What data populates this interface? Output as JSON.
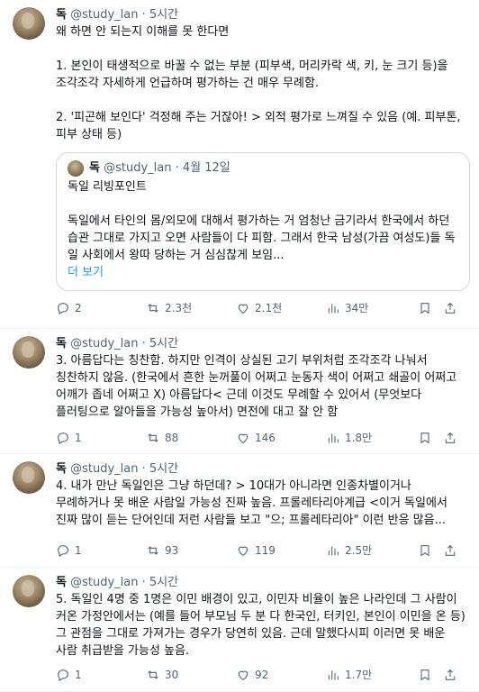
{
  "tweets": [
    {
      "name": "독",
      "handle": "@study_lan",
      "sep": "·",
      "time": "5시간",
      "paragraphs": [
        "왜 하면 안 되는지 이해를 못 한다면",
        "",
        "1. 본인이 태생적으로 바꿀 수 없는 부분 (피부색, 머리카락 색, 키, 눈 크기 등)을 조각조각 자세하게 언급하며 평가하는 건 매우 무례함.",
        "",
        "2. '피곤해 보인다' 걱정해 주는 거잖아! > 외적 평가로 느껴질 수 있음 (예. 피부톤, 피부 상태 등)"
      ],
      "quote": {
        "name": "독",
        "handle": "@study_lan",
        "sep": "·",
        "date": "4월 12일",
        "paragraphs": [
          "독일 리빙포인트",
          "",
          "독일에서 타인의 몸/외모에 대해서 평가하는 거 엄청난 금기라서 한국에서 하던 습관 그대로 가지고 오면 사람들이 다 피함. 그래서 한국 남성(가끔 여성도)들 독일 사회에서 왕따 당하는 거 심심찮게 보임..."
        ],
        "more": "더 보기"
      },
      "replies": "2",
      "retweets": "2.3천",
      "likes": "2.1천",
      "views": "34만"
    },
    {
      "name": "독",
      "handle": "@study_lan",
      "sep": "·",
      "time": "5시간",
      "paragraphs": [
        "3. 아름답다는 칭찬함. 하지만 인격이 상실된 고기 부위처럼 조각조각 나눠서 칭찬하지 않음. (한국에서 흔한 눈꺼풀이 어쩌고 눈동자 색이 어쩌고 쇄골이 어쩌고 어깨가 좁네 어쩌고 X) 아름답다< 근데 이것도 무례할 수 있어서 (무엇보다 플러팅으로 알아들을 가능성 높아서) 면전에 대고 잘 안 함"
      ],
      "replies": "1",
      "retweets": "88",
      "likes": "146",
      "views": "1.8만"
    },
    {
      "name": "독",
      "handle": "@study_lan",
      "sep": "·",
      "time": "5시간",
      "paragraphs": [
        "4. 내가 만난 독일인은 그냥 하던데? > 10대가 아니라면 인종차별이거나 무례하거나 못 배운 사람일 가능성 진짜 높음. 프롤레타리아계급 <이거 독일에서 진짜 많이 듣는 단어인데 저런 사람들 보고 \"으; 프롤레타리아\" 이런 반응 많음..."
      ],
      "replies": "1",
      "retweets": "93",
      "likes": "119",
      "views": "2.5만"
    },
    {
      "name": "독",
      "handle": "@study_lan",
      "sep": "·",
      "time": "5시간",
      "paragraphs": [
        "5. 독일인 4명 중 1명은 이민 배경이 있고, 이민자 비율이 높은 나라인데 그 사람이 커온 가정안에서는 (예를 들어 부모님 두 분 다 한국인, 터키인, 본인이 이민을 온 등) 그 관점을 그대로 가져가는 경우가 당연히 있음. 근데 말했다시피 이러면 못 배운 사람 취급받을 가능성 높음."
      ],
      "replies": "1",
      "retweets": "30",
      "likes": "92",
      "views": "1.7만"
    }
  ]
}
